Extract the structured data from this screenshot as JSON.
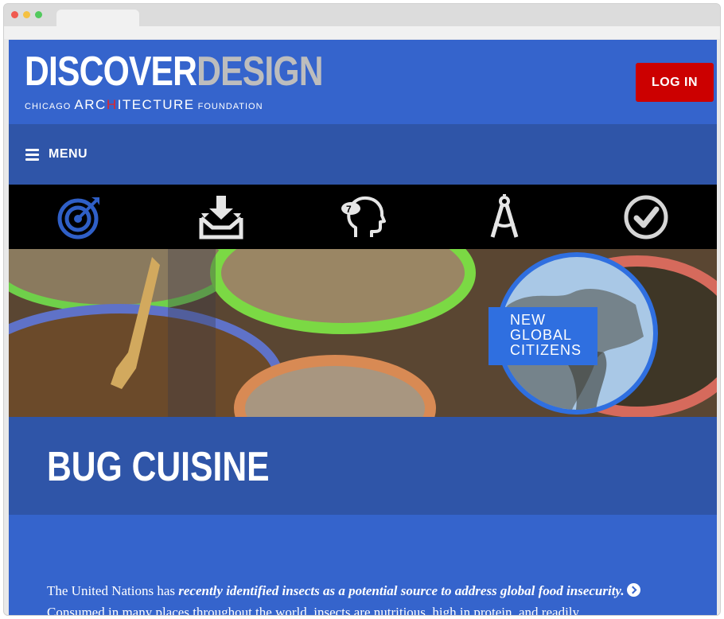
{
  "colors": {
    "header_blue": "#3564cc",
    "nav_blue": "#2f55a8",
    "login_red": "#cc0000",
    "icon_blue": "#2f5fc7",
    "icon_gray": "#e6e6e6"
  },
  "header": {
    "logo_discover": "DISCOVER",
    "logo_design": "DESIGN",
    "logo_sub_before": "CHICAGO ",
    "logo_sub_arch_a": "ARC",
    "logo_sub_arch_dot": "H",
    "logo_sub_arch_b": "ITECTURE",
    "logo_sub_after": " FOUNDATION",
    "login_label": "LOG IN"
  },
  "nav": {
    "menu_label": "MENU",
    "menu_icon": "hamburger-icon"
  },
  "icon_strip": [
    {
      "name": "target-icon",
      "active": true
    },
    {
      "name": "download-tray-icon",
      "active": false
    },
    {
      "name": "head-idea-icon",
      "active": false
    },
    {
      "name": "compass-icon",
      "active": false
    },
    {
      "name": "checkmark-circle-icon",
      "active": false
    }
  ],
  "hero": {
    "badge_line1": "NEW",
    "badge_line2": "GLOBAL",
    "badge_line3": "CITIZENS"
  },
  "page": {
    "title": "BUG CUISINE"
  },
  "body": {
    "intro": "The United Nations has ",
    "link_text": "recently identified insects as a potential source to address global food insecurity.",
    "continuation": "Consumed in many places throughout the world, insects are nutritious, high in protein, and readily"
  }
}
